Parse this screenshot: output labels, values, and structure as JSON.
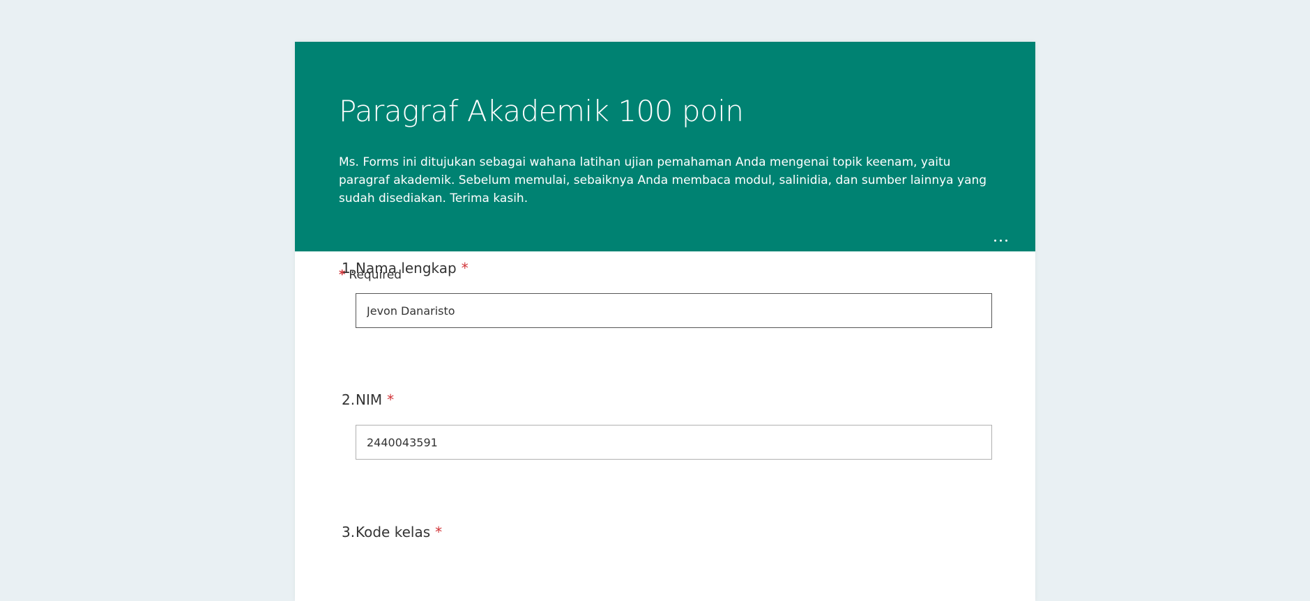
{
  "form": {
    "title": "Paragraf Akademik 100 poin",
    "description": "Ms. Forms ini ditujukan sebagai wahana latihan ujian pemahaman Anda mengenai topik keenam, yaitu paragraf akademik. Sebelum memulai, sebaiknya Anda membaca modul, salinidia, dan sumber lainnya yang sudah disediakan. Terima kasih.",
    "required_marker": "*",
    "required_text": "Required"
  },
  "colors": {
    "page_background": "#e9f0f3",
    "header_background": "#008272",
    "required_star": "#d13438"
  },
  "questions": [
    {
      "number": "1.",
      "label": "Nama lengkap",
      "required": "*",
      "value": "Jevon Danaristo"
    },
    {
      "number": "2.",
      "label": "NIM",
      "required": "*",
      "value": "2440043591"
    },
    {
      "number": "3.",
      "label": "Kode kelas",
      "required": "*"
    }
  ],
  "icons": {
    "more": "more-options-icon"
  }
}
